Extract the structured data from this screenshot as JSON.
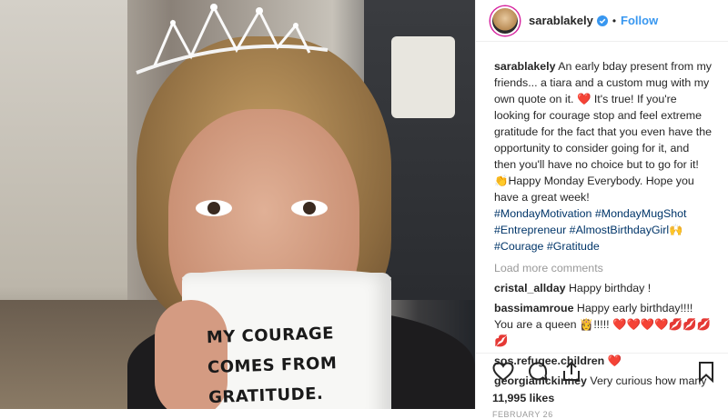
{
  "photo": {
    "mug_lines": [
      "MY COURAGE",
      "COMES FROM",
      "GRATITUDE."
    ]
  },
  "header": {
    "username": "sarablakely",
    "separator": "•",
    "follow_label": "Follow"
  },
  "caption": {
    "username": "sarablakely",
    "text_1": " An early bday present from my friends... a tiara and a custom mug with my own quote on it. ",
    "heart": "❤️",
    "text_2": " It's true! If you're looking for courage stop and feel extreme gratitude for the fact that you even have the opportunity to consider going for it, and then you'll have no choice but to go for it! ",
    "emoji_hand": "👏",
    "text_3": "Happy Monday Everybody. Hope you have a great week!",
    "hashtags": [
      "#MondayMotivation",
      "#MondayMugShot",
      "#Entrepreneur",
      "#AlmostBirthdayGirl",
      "#Courage",
      "#Gratitude"
    ],
    "emoji_end": "🙌"
  },
  "load_more": "Load more comments",
  "comments": [
    {
      "user": "cristal_allday",
      "text": "Happy birthday !"
    },
    {
      "user": "bassimamroue",
      "text": "Happy early birthday!!!! You are a queen 👸!!!!! ❤️❤️❤️❤️💋💋💋💋"
    },
    {
      "user": "sos.refugee.children",
      "text": "❤️"
    },
    {
      "user": "georgiamckinney",
      "text": "Very curious how many"
    }
  ],
  "likes": "11,995 likes",
  "time_ago": "FEBRUARY 26",
  "colors": {
    "link": "#3897f0",
    "hashtag": "#003569",
    "muted": "#999999",
    "heart": "#ed4956"
  }
}
